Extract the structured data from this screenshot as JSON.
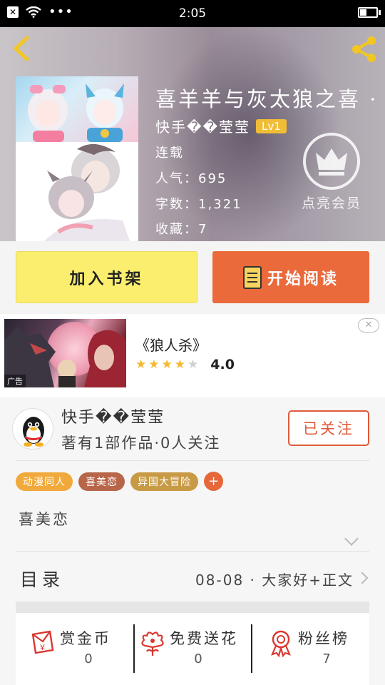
{
  "status_bar": {
    "time": "2:05",
    "dots": "•••",
    "x_icon": "x-notification-icon",
    "signal_icon": "wifi-icon",
    "battery_icon": "battery-icon"
  },
  "header": {
    "back_icon": "back-chevron-icon",
    "share_icon": "share-icon",
    "title": "喜羊羊与灰太狼之喜 ·",
    "author": "快手��莹莹",
    "level": "Lv1",
    "status": "连载",
    "popularity": "人气：695",
    "word_count": "字数：1,321",
    "collections": "收藏：7",
    "vip_label": "点亮会员",
    "vip_icon": "crown-icon"
  },
  "actions": {
    "add_to_shelf": "加入书架",
    "start_reading": "开始阅读",
    "book_icon": "book-icon"
  },
  "ad": {
    "title": "《狼人杀》",
    "rating": "4.0",
    "stars": 4,
    "tag": "广告",
    "close_icon": "close-icon"
  },
  "author_section": {
    "name": "快手��莹莹",
    "description": "著有1部作品·0人关注",
    "follow_button": "已关注",
    "avatar_icon": "qq-penguin-icon"
  },
  "tags": [
    {
      "label": "动漫同人",
      "color": "#f0a93a"
    },
    {
      "label": "喜美恋",
      "color": "#b8664a"
    },
    {
      "label": "异国大冒险",
      "color": "#c89a45"
    }
  ],
  "tag_add": "+",
  "summary": "喜美恋",
  "toc": {
    "label": "目录",
    "latest": "08-08 · 大家好+正文"
  },
  "stats": [
    {
      "label": "赏金币",
      "value": "0",
      "icon": "red-envelope-icon"
    },
    {
      "label": "免费送花",
      "value": "0",
      "icon": "flower-icon"
    },
    {
      "label": "粉丝榜",
      "value": "7",
      "icon": "medal-icon"
    }
  ],
  "colors": {
    "accent_orange": "#ea6a3c",
    "shelf_yellow": "#fbee6e",
    "follow_red": "#e05a3a"
  }
}
